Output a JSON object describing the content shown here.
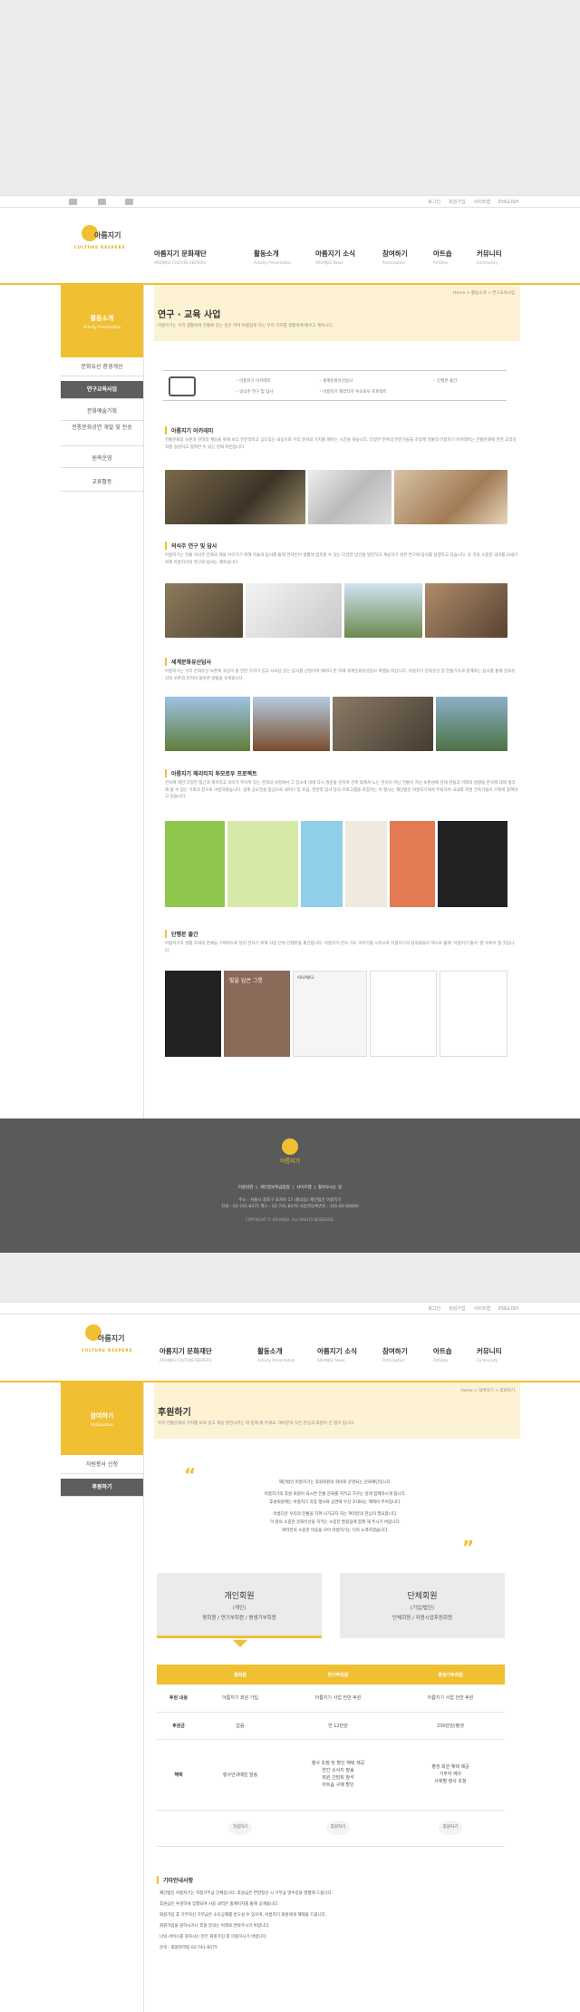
{
  "colors": {
    "accent": "#f0c032",
    "footer": "#5a5a5a",
    "lnb_active": "#5e5e5e"
  },
  "util": [
    "로그인",
    "회원가입",
    "사이트맵",
    "ENGLISH"
  ],
  "sns": [
    "facebook-icon",
    "twitter-icon",
    "youtube-icon"
  ],
  "logo": {
    "text": "아름지기",
    "sub": "CULTURE KEEPERS"
  },
  "gnb": [
    {
      "label": "아름지기 문화재단",
      "sub": "ARUMJIGI CULTURE KEEPERS"
    },
    {
      "label": "활동소개",
      "sub": "Activity Presentation"
    },
    {
      "label": "아름지기 소식",
      "sub": "ARUMJIGI News"
    },
    {
      "label": "참여하기",
      "sub": "Participation"
    },
    {
      "label": "아트숍",
      "sub": "ArtShop"
    },
    {
      "label": "커뮤니티",
      "sub": "Community"
    }
  ],
  "page1": {
    "lnb": {
      "title": "활동소개",
      "sub": "Activity Presentation",
      "items": [
        "문화유산 환경개선",
        "연구교육사업",
        "문화예술기획",
        "전통문화공연 개발 및 전승",
        "원족운영",
        "교류활동"
      ]
    },
    "location": "Home > 활동소개 > 연구교육사업",
    "title": "연구 · 교육 사업",
    "desc": "아름지기는 우리 생활속에 전통에 있는 깊은 하며 아름답게 하는 우리 가치를 생활속에 배우고 계속니다.",
    "book_links": [
      "아름지기 아카데미",
      "세계문화유산답사",
      "단행본 출간",
      "의식주 연구 및 답사",
      "아름지기 헤리티지 투모로우 프로젝트"
    ],
    "sections": [
      {
        "title": "아름지기 아카데미",
        "desc": "전통문화의 보존과 현대적 계승을 위해 보다 전문적이고 심도있는 내용으로 우리 문화의 가치를 배우는 시간을 갖습니다. 다양한 분야의 전문가들을 초빙해 전통적 아름지기 아카데미는 전통문화에 관한 교양강좌를 형성하고 참여한 수 있는 문화 마련합니다."
      },
      {
        "title": "의식주 연구 및 답사",
        "desc": "아름지기는 전통 의식주 문화의 맥을 이어가기 위해 학술과 답사를 통해 현대인이 생활에 접목할 수 있는 다양한 방안을 발전하고 계승하기 위한 연구와 답사를 실행하고 있습니다. 옷 것의 소중한 의미를 되새기 위해 아름지기의 연구와 답사는 계속됩니다."
      },
      {
        "title": "세계문화유산답사",
        "desc": "아름지기는 우리 문화유산 보존에 귀감이 될 만한 가치가 있고 사서상 있는 답사를 선정하여 해마다 한 차례 세계문화유산답사 여행을 떠납니다. 아름지기 문화유산 및 전통가옥과 함께하는 답사를 통해 문화유산의 보존과 관리의 올바른 방법을 모색합니다."
      },
      {
        "title": "아름지기 헤리티지 투모로우 프로젝트",
        "desc": "한옥에 대한 다양한 접근과 해석하고 의미가 주어져 있는 현대의 사업에서 그 장소에 대해 다시 질문을 던지며 건축 밖에서 노는 한옥이 아닌 전통이 지닌 보편성에 관해 현실과 미래의 방향을 한옥에 대해 생각해 볼 수 있는 기회의 장으로 마련하였습니다. 설계 공모전을 중심으로 세미나 및 포럼, 전반적 답사 등의 프로그램을 포함하는 이 행사는 재단법인 아름지기에서 주최하며 국내외 저명 건축가들이 기획에 참여하고 있습니다."
      },
      {
        "title": "단행본 출간",
        "desc": "아름지기의 생활 조화의 연세들 구체적으로 달리 전하기 위해 사업 단위 단행본을 출간합니다. 아름지기 한옥 기도 이야기를 시작으로 아름지기의 성과물들이 책으로 통해 ‘아름지기 출서’ 할 이루어 질 것입니다."
      }
    ],
    "book_covers": [
      "빛을 담은 그릇",
      "",
      "ARUMJIGI",
      "",
      ""
    ]
  },
  "footer": {
    "logo": "아름지기",
    "links": [
      "이용약관",
      "개인정보취급방침",
      "이메일무단수집거부",
      "사이트맵",
      "찾아오시는 길"
    ],
    "addr1": "주소 : 서울시 종로구 효자로 17 (통의동) 재단법인 아름지기",
    "addr2": "전화 : 02-741-8375   팩스 : 02-741-8376   사업자등록번호 : 101-82-00000",
    "copy": "COPYRIGHT © ARUMJIGI. ALL RIGHTS RESERVED."
  },
  "page2": {
    "lnb": {
      "title": "참여하기",
      "sub": "Participation",
      "items": [
        "자원봉사 신청",
        "후원하기"
      ]
    },
    "location": "Home > 참여하기 > 후원하기",
    "title": "후원하기",
    "desc": "우리 전통문화의 가치를 바로 알고 계승 발전시키는 데 함께 해 주세요. 여러분의 작은 관심과 후원이 큰 힘이 됩니다.",
    "message": [
      "재단법인 아름지기는 후원회원의 회비로 운영되는 문화재단입니다.",
      "아름지기의 후원 회원이 되시면 전통 문화를 지키고 가꾸는 일에 함께하시게 됩니다.",
      "후원회원께는 아름지기 각종 행사와 공연에 우선 초대되는 혜택이 주어집니다.",
      "아름다운 우리의 전통을 지켜 나가고자 하는 여러분의 관심이 필요합니다.",
      "이 땅의 소중한 문화유산을 지키는 소중한 발걸음에 함께 해 주시기 바랍니다.",
      "여러분의 소중한 마음을 모아 아름지기는 더욱 노력하겠습니다."
    ],
    "member_types": [
      {
        "title": "개인회원",
        "sub1": "(개인)",
        "sub2": "평회원 / 연기부회원 / 평생기부회원"
      },
      {
        "title": "단체회원",
        "sub1": "(기업/법인)",
        "sub2": "단체회원 / 자원시업후원회원"
      }
    ],
    "table": {
      "headers": [
        "",
        "평회원",
        "연기부회원",
        "평생기부회원"
      ],
      "rows": [
        {
          "label": "후원 내용",
          "cells": [
            "아름지기 회원 가입",
            "아름지기 사업 전반 후원",
            "아름지기 사업 전반 후원"
          ]
        },
        {
          "label": "후원금",
          "cells": [
            "없음",
            "연 12만원",
            "200만원/평생"
          ]
        },
        {
          "label": "혜택",
          "cells": [
            "행사안내메일 발송",
            "행사 초청 및 할인 혜택 제공\n연간 소식지 발송\n회원 간담회 참석\n아트숍 구매 할인",
            "평생 회원 혜택 제공\n기부자 예우\n사례별 행사 초청"
          ]
        },
        {
          "label": "",
          "cells": [
            "가입하기",
            "후원하기",
            "후원하기"
          ]
        }
      ]
    },
    "guide_title": "기타안내사항",
    "guide": [
      "재단법인 아름지기는 지정기부금 단체입니다. 후원금은 연말정산 시 기부금 영수증을 발행해 드립니다.",
      "후원금은 투명하게 집행되며 사용 내역은 홈페이지를 통해 공개됩니다.",
      "회원가입 후 기부하신 기부금은 소득공제를 받으실 수 있으며, 아름지기 회원에게 혜택을 드립니다.",
      "회원가입을 원하시거나 후원 문의는 아래로 연락주시기 바랍니다.",
      "나의 서비스를 원하시는 분은 회원가입 후 이용하시기 바랍니다.",
      "문의 : 회원관리팀 02-741-8375"
    ]
  }
}
